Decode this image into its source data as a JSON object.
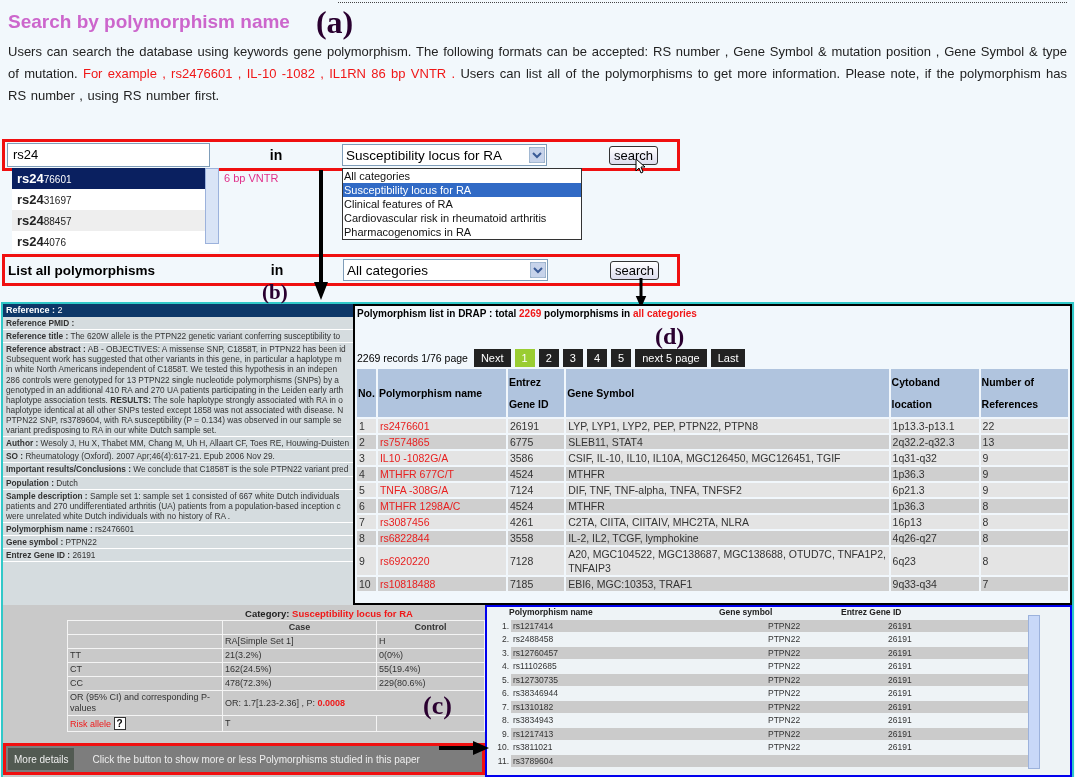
{
  "annotations": [
    "(a)",
    "(b)",
    "(c)",
    "(d)"
  ],
  "search_section": {
    "title": "Search by polymorphism name",
    "intro": [
      {
        "kind": "plain",
        "text": "Users can search the database using keywords gene polymorphism. The following formats can be accepted: RS number , Gene Symbol & mutation position  , Gene Symbol & type of mutation. "
      },
      {
        "kind": "example",
        "text": "For example , rs2476601 , IL-10 -1082 , IL1RN 86 bp VNTR ."
      },
      {
        "kind": "plain",
        "text": " Users can list all of the polymorphisms to get more information. Please note, if the polymorphism has RS number , using RS number first."
      }
    ]
  },
  "keyword_search": {
    "value": "rs24",
    "in_label": "in",
    "category": "Susceptibility locus for RA",
    "button": "search"
  },
  "example_fragment": "6 bp VNTR",
  "suggestions": [
    {
      "match": "rs24",
      "rest": "76601",
      "selected": true
    },
    {
      "match": "rs24",
      "rest": "31697",
      "selected": false
    },
    {
      "match": "rs24",
      "rest": "88457",
      "selected": false
    },
    {
      "match": "rs24",
      "rest": "4076",
      "selected": false
    }
  ],
  "category_options": [
    {
      "label": "All categories",
      "selected": false
    },
    {
      "label": "Susceptibility locus for RA",
      "selected": true
    },
    {
      "label": "Clinical features of RA",
      "selected": false
    },
    {
      "label": "Cardiovascular risk in rheumatoid arthritis",
      "selected": false
    },
    {
      "label": "Pharmacogenomics in RA",
      "selected": false
    }
  ],
  "list_all": {
    "label": "List all polymorphisms",
    "in_label": "in",
    "category": "All categories",
    "button": "search"
  },
  "reference_detail": {
    "header": {
      "label": "Reference :",
      "value": "2"
    },
    "fields": [
      {
        "label": "Reference PMID :"
      },
      {
        "label": "Reference title :",
        "value": "The 620W allele is the PTPN22 genetic variant conferring susceptibility to"
      },
      {
        "label": "Reference abstract :",
        "value": "AB - OBJECTIVES: A missense SNP, C1858T, in PTPN22 has been id Subsequent work has suggested that other variants in this gene, in particular a haplotype m in white North Americans independent of C1858T. We tested this hypothesis in an indepen 286 controls were genotyped for 13 PTPN22 single nucleotide polymorphisms (SNPs) by a genotyped in an additional 410 RA and 270 UA patients participating in the Leiden early arth haplotype association tests. **RESULTS:** The sole haplotype strongly associated with RA in o haplotype identical at all other SNPs tested except 1858 was not associated with disease. N PTPN22 SNP, rs3789604, with RA susceptibility (P = 0.134) was observed in our sample se variant predisposing to RA in our white Dutch sample set."
      },
      {
        "label": "Author :",
        "value": "Wesoly J, Hu X, Thabet MM, Chang M, Uh H, Allaart CF, Toes RE, Houwing-Duisten"
      },
      {
        "label": "SO :",
        "value": "Rheumatology (Oxford). 2007 Apr;46(4):617-21. Epub 2006 Nov 29."
      },
      {
        "label": "Important results/Conclusions :",
        "value": "We conclude that C1858T is the sole PTPN22 variant pred"
      },
      {
        "label": "Population :",
        "value": "Dutch"
      },
      {
        "label": "Sample description :",
        "value": "Sample set 1: sample set 1 consisted of 667 white Dutch individuals patients and 270 undifferentiated arthritis (UA) patients from a population-based inception c were unrelated white Dutch individuals with no history of RA ."
      },
      {
        "label": "Polymorphism name :",
        "value": "rs2476601"
      },
      {
        "label": "Gene symbol :",
        "value": "PTPN22"
      },
      {
        "label": "Entrez Gene ID :",
        "value": "26191"
      }
    ]
  },
  "polymorphism_list": {
    "heading_start": "Polymorphism list in DRAP : total ",
    "total": "2269",
    "heading_middle": " polymorphisms in ",
    "scope": "all categories",
    "records": "2269 records 1/76 page",
    "pages": [
      {
        "label": "Next",
        "selected": false
      },
      {
        "label": "1",
        "selected": true
      },
      {
        "label": "2",
        "selected": false
      },
      {
        "label": "3",
        "selected": false
      },
      {
        "label": "4",
        "selected": false
      },
      {
        "label": "5",
        "selected": false
      },
      {
        "label": "next 5 page",
        "selected": false
      },
      {
        "label": "Last",
        "selected": false
      }
    ],
    "columns": [
      "No.",
      "Polymorphism name",
      "Entrez Gene ID",
      "Gene Symbol",
      "Cytoband location",
      "Number of References"
    ],
    "rows": [
      [
        "1",
        "rs2476601",
        "26191",
        "LYP, LYP1, LYP2, PEP, PTPN22, PTPN8",
        "1p13.3-p13.1",
        "22"
      ],
      [
        "2",
        "rs7574865",
        "6775",
        "SLEB11, STAT4",
        "2q32.2-q32.3",
        "13"
      ],
      [
        "3",
        "IL10 -1082G/A",
        "3586",
        "CSIF, IL-10, IL10, IL10A, MGC126450, MGC126451, TGIF",
        "1q31-q32",
        "9"
      ],
      [
        "4",
        "MTHFR 677C/T",
        "4524",
        "MTHFR",
        "1p36.3",
        "9"
      ],
      [
        "5",
        "TNFA -308G/A",
        "7124",
        "DIF, TNF, TNF-alpha, TNFA, TNFSF2",
        "6p21.3",
        "9"
      ],
      [
        "6",
        "MTHFR 1298A/C",
        "4524",
        "MTHFR",
        "1p36.3",
        "8"
      ],
      [
        "7",
        "rs3087456",
        "4261",
        "C2TA, CIITA, CIITAIV, MHC2TA, NLRA",
        "16p13",
        "8"
      ],
      [
        "8",
        "rs6822844",
        "3558",
        "IL-2, IL2, TCGF, lymphokine",
        "4q26-q27",
        "8"
      ],
      [
        "9",
        "rs6920220",
        "7128",
        "A20, MGC104522, MGC138687, MGC138688, OTUD7C, TNFA1P2, TNFAIP3",
        "6q23",
        "8"
      ],
      [
        "10",
        "rs10818488",
        "7185",
        "EBI6, MGC:10353, TRAF1",
        "9q33-q34",
        "7"
      ]
    ]
  },
  "category_results": {
    "label": "Category: ",
    "category": "Susceptibility locus for RA",
    "columns": [
      "Case",
      "Control"
    ],
    "groups": [
      "RA[Simple Set 1]",
      "H"
    ],
    "rows": [
      {
        "kind": "genotype",
        "label": "TT",
        "case": "21(3.2%)",
        "control": "0(0%)"
      },
      {
        "kind": "genotype",
        "label": "CT",
        "case": "162(24.5%)",
        "control": "55(19.4%)"
      },
      {
        "kind": "genotype",
        "label": "CC",
        "case": "478(72.3%)",
        "control": "229(80.6%)"
      },
      {
        "kind": "odds",
        "label": "OR (95% CI) and corresponding P-values",
        "case": "OR:  1.7[1.23-2.36]  ,  P: ",
        "p_value": "0.0008"
      },
      {
        "kind": "risk",
        "label": "Risk allele",
        "help": "?",
        "case": "T"
      }
    ],
    "more_button": "More details",
    "more_hint": "Click the button to show more or less Polymorphisms studied in this paper"
  },
  "related_polymorphisms": {
    "columns": [
      "Polymorphism name",
      "Gene symbol",
      "Entrez Gene ID"
    ],
    "rows": [
      {
        "no": "1.",
        "name": "rs1217414",
        "gene": "PTPN22",
        "id": "26191"
      },
      {
        "no": "2.",
        "name": "rs2488458",
        "gene": "PTPN22",
        "id": "26191"
      },
      {
        "no": "3.",
        "name": "rs12760457",
        "gene": "PTPN22",
        "id": "26191"
      },
      {
        "no": "4.",
        "name": "rs11102685",
        "gene": "PTPN22",
        "id": "26191"
      },
      {
        "no": "5.",
        "name": "rs12730735",
        "gene": "PTPN22",
        "id": "26191"
      },
      {
        "no": "6.",
        "name": "rs38346944",
        "gene": "PTPN22",
        "id": "26191"
      },
      {
        "no": "7.",
        "name": "rs1310182",
        "gene": "PTPN22",
        "id": "26191"
      },
      {
        "no": "8.",
        "name": "rs3834943",
        "gene": "PTPN22",
        "id": "26191"
      },
      {
        "no": "9.",
        "name": "rs1217413",
        "gene": "PTPN22",
        "id": "26191"
      },
      {
        "no": "10.",
        "name": "rs3811021",
        "gene": "PTPN22",
        "id": "26191"
      },
      {
        "no": "11.",
        "name": "rs3789604"
      }
    ]
  }
}
